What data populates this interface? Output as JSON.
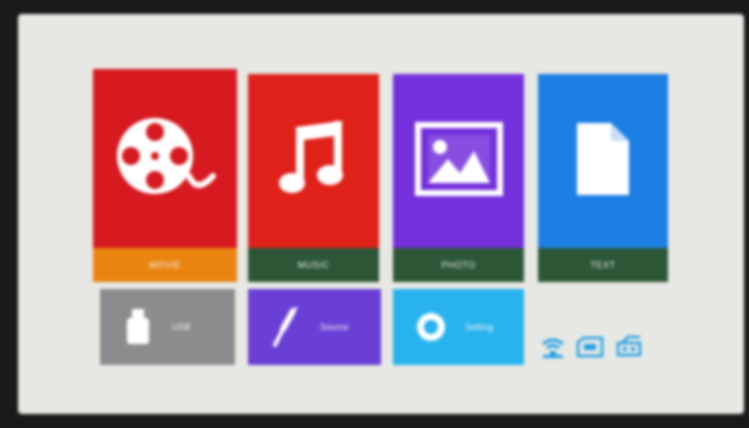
{
  "tiles": {
    "movie": {
      "label": "MOVIE",
      "icon": "film-reel-icon",
      "color": "#d61a20",
      "label_color": "#ea8410"
    },
    "music": {
      "label": "MUSIC",
      "icon": "music-note-icon",
      "color": "#e02119",
      "label_color": "#2c5636"
    },
    "photo": {
      "label": "PHOTO",
      "icon": "image-icon",
      "color": "#7330dc",
      "label_color": "#2c5636"
    },
    "text": {
      "label": "TEXT",
      "icon": "document-icon",
      "color": "#1d7fe4",
      "label_color": "#2c5636"
    }
  },
  "shortcuts": {
    "usb": {
      "label": "USB",
      "icon": "usb-drive-icon",
      "color": "#8c8c8e"
    },
    "source": {
      "label": "Source",
      "icon": "cable-icon",
      "color": "#6a3fd6"
    },
    "setting": {
      "label": "Setting",
      "icon": "gear-icon",
      "color": "#28b3ee"
    }
  },
  "status_icons": [
    "network-icon",
    "sd-card-icon",
    "usb-status-icon"
  ]
}
